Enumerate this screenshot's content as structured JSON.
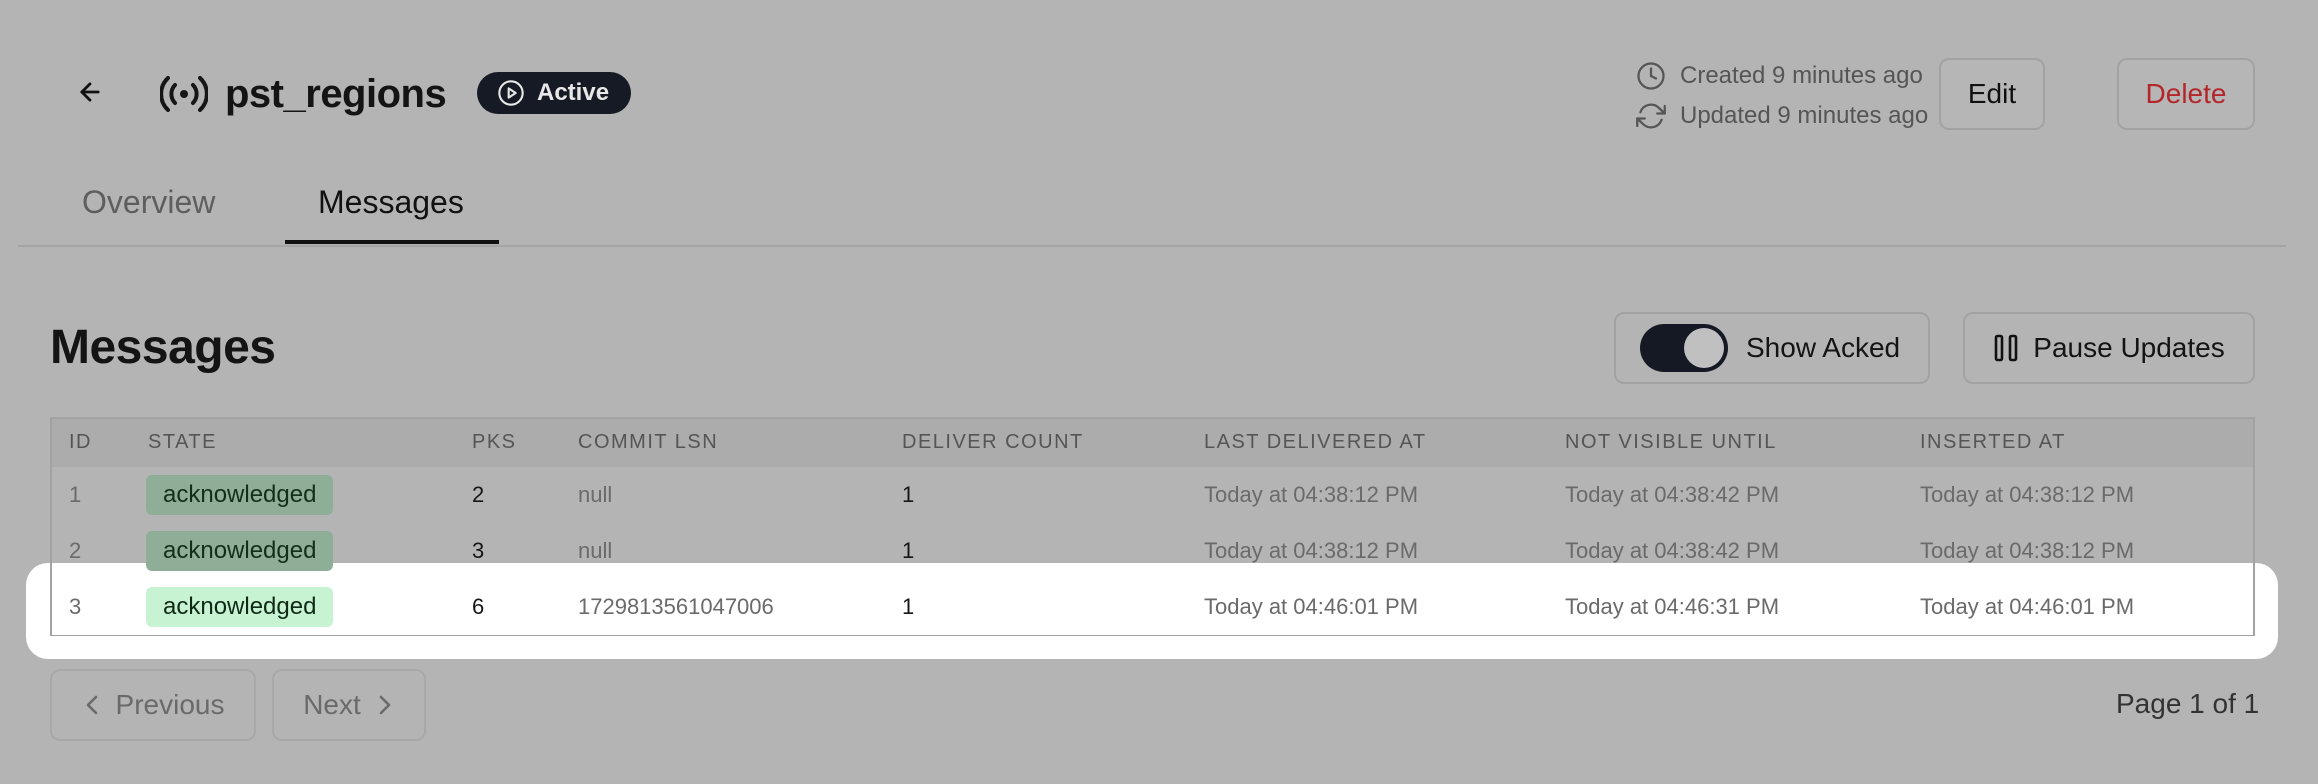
{
  "header": {
    "title": "pst_regions",
    "status": "Active",
    "created": "Created 9 minutes ago",
    "updated": "Updated 9 minutes ago",
    "edit_label": "Edit",
    "delete_label": "Delete"
  },
  "tabs": [
    {
      "label": "Overview",
      "active": false
    },
    {
      "label": "Messages",
      "active": true
    }
  ],
  "section": {
    "title": "Messages",
    "toggle_label": "Show Acked",
    "toggle_on": true,
    "pause_label": "Pause Updates"
  },
  "table": {
    "columns": [
      "ID",
      "STATE",
      "PKS",
      "COMMIT LSN",
      "DELIVER COUNT",
      "LAST DELIVERED AT",
      "NOT VISIBLE UNTIL",
      "INSERTED AT"
    ],
    "rows": [
      {
        "id": "1",
        "state": "acknowledged",
        "pks": "2",
        "commit_lsn": "null",
        "deliver_count": "1",
        "last_delivered_at": "Today at 04:38:12 PM",
        "not_visible_until": "Today at 04:38:42 PM",
        "inserted_at": "Today at 04:38:12 PM"
      },
      {
        "id": "2",
        "state": "acknowledged",
        "pks": "3",
        "commit_lsn": "null",
        "deliver_count": "1",
        "last_delivered_at": "Today at 04:38:12 PM",
        "not_visible_until": "Today at 04:38:42 PM",
        "inserted_at": "Today at 04:38:12 PM"
      },
      {
        "id": "3",
        "state": "acknowledged",
        "pks": "6",
        "commit_lsn": "1729813561047006",
        "deliver_count": "1",
        "last_delivered_at": "Today at 04:46:01 PM",
        "not_visible_until": "Today at 04:46:31 PM",
        "inserted_at": "Today at 04:46:01 PM"
      }
    ]
  },
  "pagination": {
    "previous_label": "Previous",
    "next_label": "Next",
    "page_info": "Page 1 of 1"
  },
  "colors": {
    "overlay_bg": "#b4b4b4",
    "badge_active": "#161a24",
    "delete_text": "#b4262a",
    "ack_badge": "#c8f3d3"
  }
}
